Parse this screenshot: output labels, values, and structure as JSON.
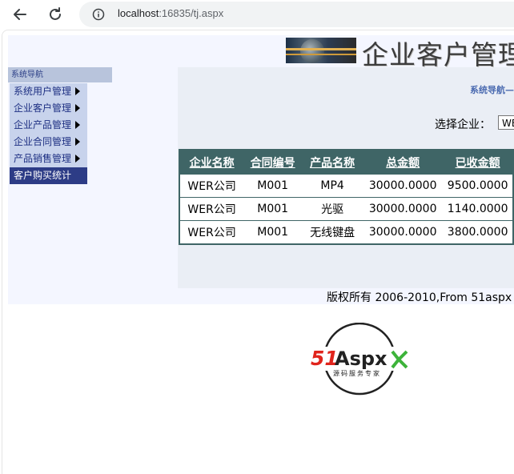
{
  "browser": {
    "url_host": "localhost",
    "url_rest": ":16835/tj.aspx"
  },
  "header": {
    "title": "企业客户管理"
  },
  "sidebar": {
    "header": "系统导航",
    "items": [
      {
        "label": "系统用户管理"
      },
      {
        "label": "企业客户管理"
      },
      {
        "label": "企业产品管理"
      },
      {
        "label": "企业合同管理"
      },
      {
        "label": "产品销售管理"
      },
      {
        "label": "客户购买统计"
      }
    ]
  },
  "main": {
    "breadcrumb": "系统导航—",
    "select_label": "选择企业：",
    "select_value": "WER公司"
  },
  "table": {
    "headers": [
      "企业名称",
      "合同编号",
      "产品名称",
      "总金额",
      "已收金额"
    ],
    "rows": [
      [
        "WER公司",
        "M001",
        "MP4",
        "30000.0000",
        "9500.0000"
      ],
      [
        "WER公司",
        "M001",
        "光驱",
        "30000.0000",
        "1140.0000"
      ],
      [
        "WER公司",
        "M001",
        "无线键盘",
        "30000.0000",
        "3800.0000"
      ]
    ]
  },
  "footer": {
    "copyright": "版权所有  2006-2010,From 51aspx"
  },
  "logo": {
    "brand_part1": "51",
    "brand_part2": "Aspx",
    "slogan": "源码服务专家"
  },
  "colors": {
    "table_header": "#3f6566",
    "sidebar_item": "#c8d3ec",
    "sidebar_active": "#2d3c86",
    "logo_red": "#e0241c",
    "logo_green": "#3db33a"
  }
}
